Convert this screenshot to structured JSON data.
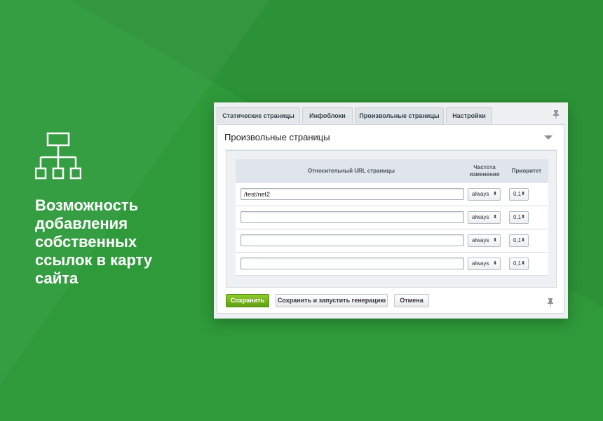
{
  "promo": {
    "icon": "sitemap-icon",
    "lines": [
      "Возможность",
      "добавления",
      "собственных",
      "ссылок в карту",
      "сайта"
    ]
  },
  "tabs": [
    {
      "label": "Статические страницы",
      "active": false
    },
    {
      "label": "Инфоблоки",
      "active": false
    },
    {
      "label": "Произвольные страницы",
      "active": true
    },
    {
      "label": "Настройки",
      "active": false
    }
  ],
  "section": {
    "title": "Произвольные страницы"
  },
  "table": {
    "headers": {
      "url": "Относительный URL страницы",
      "freq_line1": "Частота",
      "freq_line2": "изменения",
      "priority": "Приоритет"
    },
    "rows": [
      {
        "url": "/test/net2",
        "freq": "always",
        "priority": "0,1"
      },
      {
        "url": "",
        "freq": "always",
        "priority": "0,1"
      },
      {
        "url": "",
        "freq": "always",
        "priority": "0,1"
      },
      {
        "url": "",
        "freq": "always",
        "priority": "0,1"
      }
    ]
  },
  "buttons": {
    "save": "Сохранить",
    "save_generate": "Сохранить и запустить генерацию",
    "cancel": "Отмена"
  },
  "colors": {
    "background": "#2e9a3a",
    "save_button": "#6fb31c"
  }
}
